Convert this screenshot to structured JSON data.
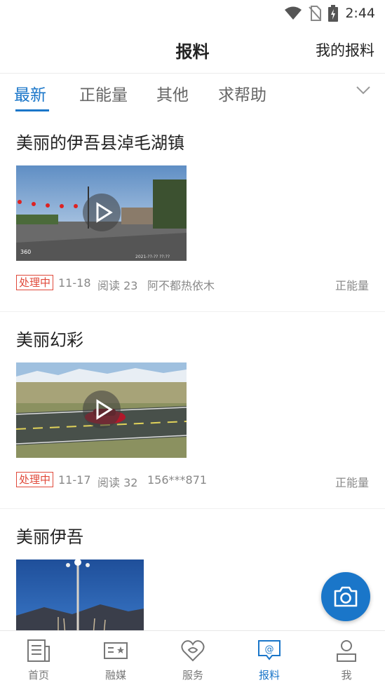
{
  "status_bar": {
    "time": "2:44"
  },
  "header": {
    "title": "报料",
    "my_reports": "我的报料"
  },
  "tabs": [
    {
      "label": "最新",
      "active": true
    },
    {
      "label": "正能量",
      "active": false
    },
    {
      "label": "其他",
      "active": false
    },
    {
      "label": "求帮助",
      "active": false
    }
  ],
  "feed": [
    {
      "title": "美丽的伊吾县淖毛湖镇",
      "badge": "处理中",
      "date": "11-18",
      "reads": "阅读 23",
      "author": "阿不都热依木",
      "category": "正能量",
      "thumb_stamp_left": "360",
      "thumb_stamp_right": "2021-??-?? ??:??"
    },
    {
      "title": "美丽幻彩",
      "badge": "处理中",
      "date": "11-17",
      "reads": "阅读 32",
      "author": "156***871",
      "category": "正能量"
    },
    {
      "title": "美丽伊吾"
    }
  ],
  "bottom_nav": [
    {
      "label": "首页",
      "icon": "news-icon"
    },
    {
      "label": "融媒",
      "icon": "media-icon"
    },
    {
      "label": "服务",
      "icon": "heart-icon"
    },
    {
      "label": "报料",
      "icon": "report-icon",
      "active": true
    },
    {
      "label": "我",
      "icon": "user-icon"
    }
  ],
  "colors": {
    "accent": "#1a76c9",
    "badge": "#e0493a"
  }
}
